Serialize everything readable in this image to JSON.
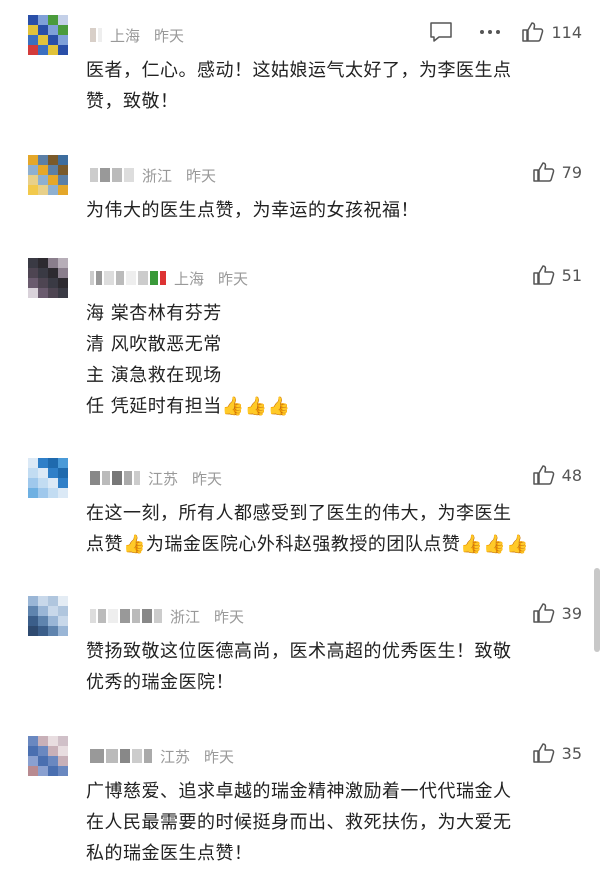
{
  "comments": [
    {
      "location": "上海",
      "time": "昨天",
      "likes": "114",
      "show_reply": true,
      "show_more": true,
      "lines": [
        "医者，仁心。感动！这姑娘运气太好了，为李医生点",
        "赞，致敬！"
      ]
    },
    {
      "location": "浙江",
      "time": "昨天",
      "likes": "79",
      "show_reply": false,
      "show_more": false,
      "lines": [
        "为伟大的医生点赞，为幸运的女孩祝福！"
      ]
    },
    {
      "location": "上海",
      "time": "昨天",
      "likes": "51",
      "show_reply": false,
      "show_more": false,
      "lines": [
        "海 棠杏林有芬芳",
        "清 风吹散恶无常",
        "主 演急救在现场",
        "任 凭延时有担当👍👍👍"
      ]
    },
    {
      "location": "江苏",
      "time": "昨天",
      "likes": "48",
      "show_reply": false,
      "show_more": false,
      "lines": [
        "在这一刻，所有人都感受到了医生的伟大，为李医生",
        "点赞👍为瑞金医院心外科赵强教授的团队点赞👍👍👍"
      ]
    },
    {
      "location": "浙江",
      "time": "昨天",
      "likes": "39",
      "show_reply": false,
      "show_more": false,
      "lines": [
        "赞扬致敬这位医德高尚，医术高超的优秀医生！致敬",
        "优秀的瑞金医院！"
      ]
    },
    {
      "location": "江苏",
      "time": "昨天",
      "likes": "35",
      "show_reply": false,
      "show_more": false,
      "lines": [
        "广博慈爱、追求卓越的瑞金精神激励着一代代瑞金人",
        "在人民最需要的时候挺身而出、救死扶伤，为大爱无",
        "私的瑞金医生点赞！"
      ]
    }
  ],
  "icons": {
    "reply": "comment-bubble-icon",
    "more": "more-dots-icon",
    "like": "thumbs-up-icon"
  },
  "colors": {
    "meta_text": "#999999",
    "body_text": "#222222",
    "icon": "#555555"
  }
}
